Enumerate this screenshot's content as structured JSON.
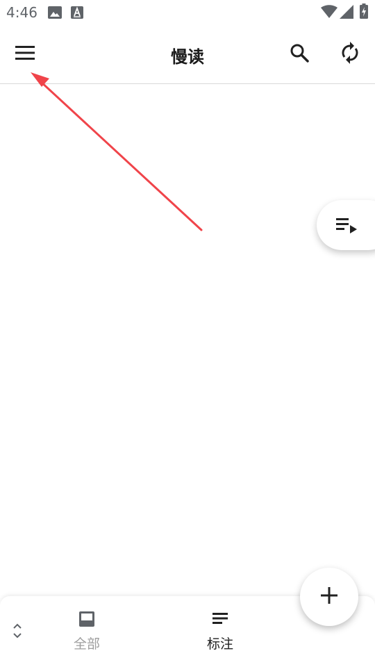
{
  "status_bar": {
    "time": "4:46",
    "icons": [
      "image-icon",
      "a-icon",
      "wifi-icon",
      "signal-icon",
      "battery-icon"
    ]
  },
  "app_bar": {
    "title": "慢读",
    "left_icon": "menu-icon",
    "right_icons": [
      "search-icon",
      "sync-icon"
    ]
  },
  "side_button": {
    "icon": "playlist-play-icon"
  },
  "bottom_nav": {
    "items": [
      {
        "label": "全部",
        "icon": "inbox-icon",
        "color": "#9e9e9e"
      },
      {
        "label": "标注",
        "icon": "notes-icon",
        "color": "#212121"
      }
    ],
    "expand_icon": "unfold-icon"
  },
  "fab": {
    "icon": "plus-icon"
  },
  "colors": {
    "annotation_arrow": "#f0444a",
    "icon_dark": "#212121",
    "icon_gray": "#5f6368"
  }
}
